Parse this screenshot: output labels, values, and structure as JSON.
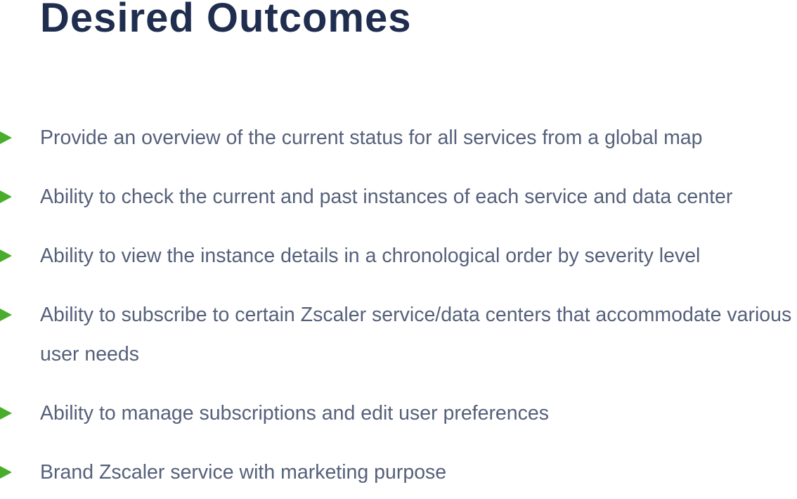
{
  "title": "Desired Outcomes",
  "bullet_icon": "play-triangle-icon",
  "colors": {
    "title": "#1f2d4e",
    "text": "#55607a",
    "bullet": "#49ad2c"
  },
  "items": [
    {
      "text": "Provide an overview of the current status for all services from a global map"
    },
    {
      "text": "Ability to check the current and past instances of each service and data center"
    },
    {
      "text": "Ability to view the instance details in a chronological order by severity level"
    },
    {
      "text": "Ability to subscribe to certain Zscaler service/data centers that accommodate various user needs"
    },
    {
      "text": "Ability to manage subscriptions and edit user preferences"
    },
    {
      "text": "Brand Zscaler service with marketing purpose"
    }
  ]
}
